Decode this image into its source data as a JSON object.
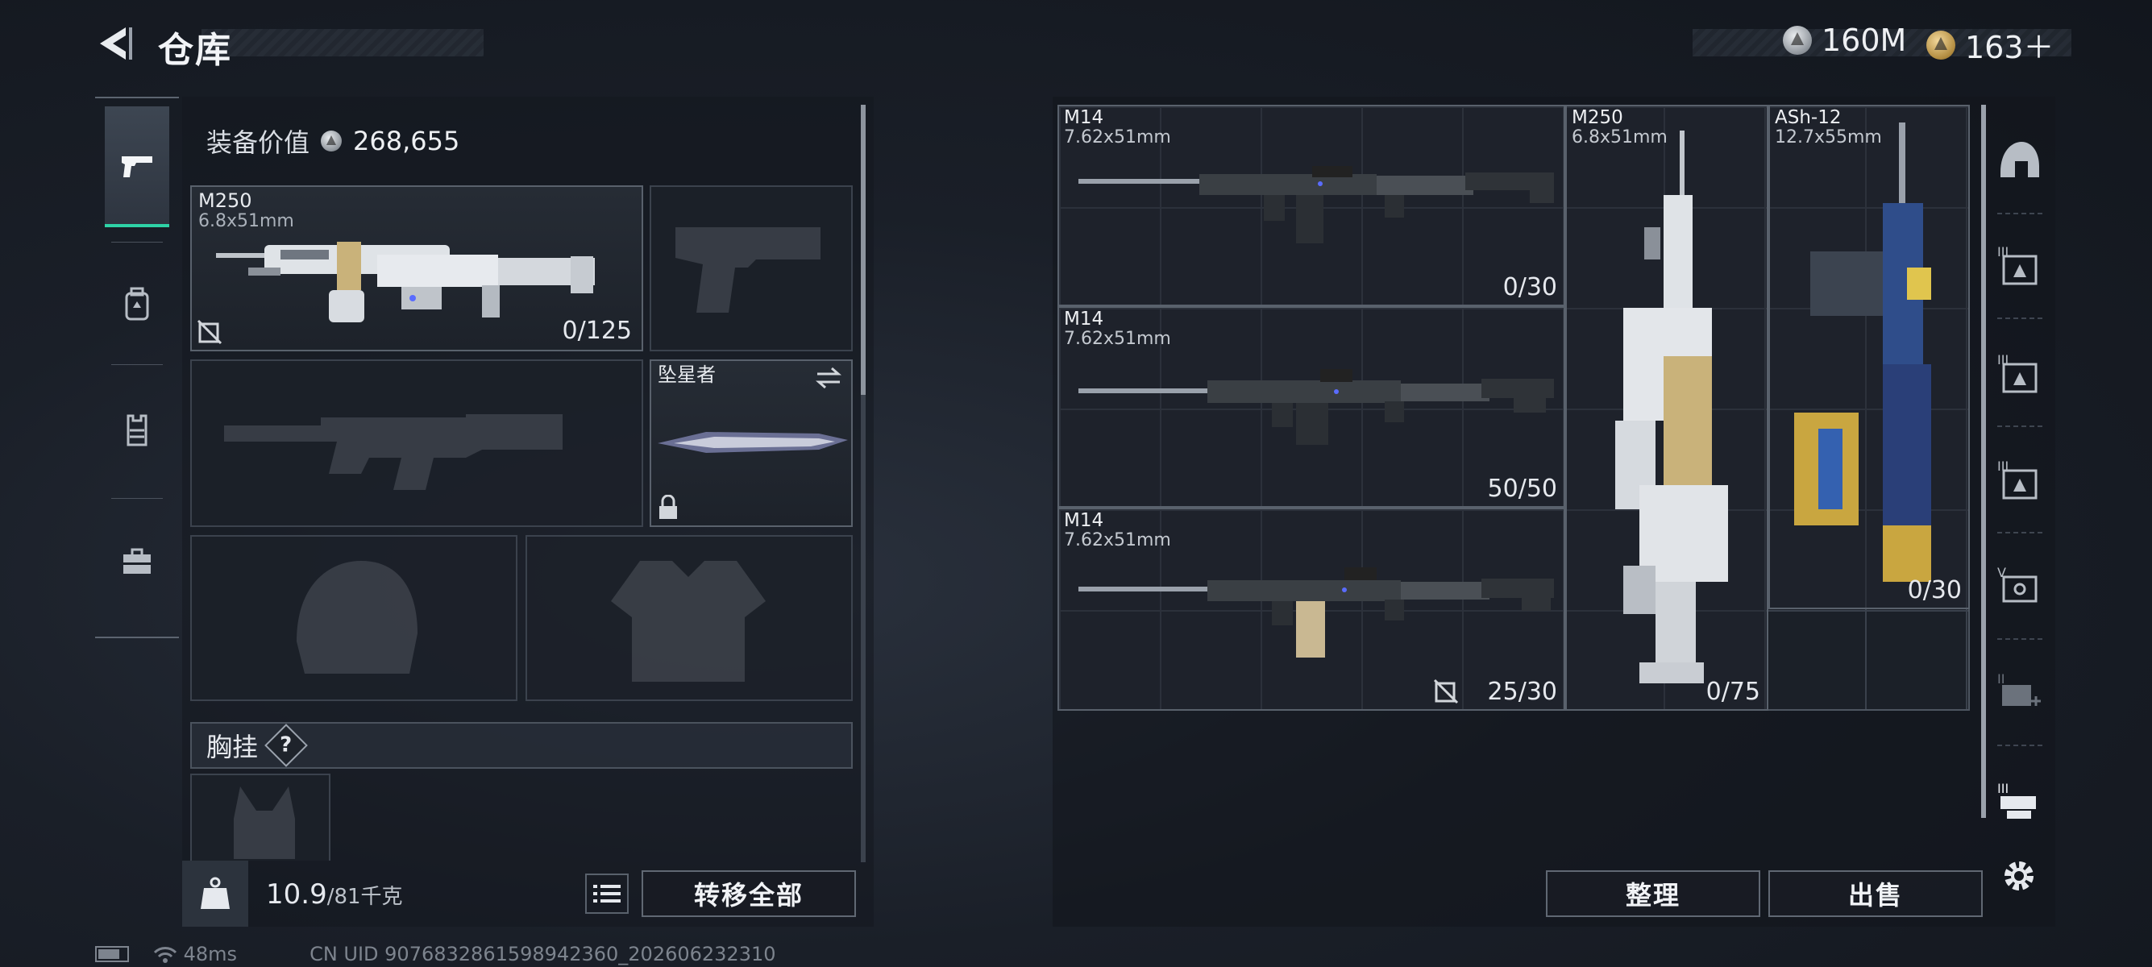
{
  "header": {
    "back_icon": "back-arrow-icon",
    "title": "仓库",
    "currency": [
      {
        "icon": "silver-coin-icon",
        "value": "160M"
      },
      {
        "icon": "gold-coin-icon",
        "value": "163＋"
      }
    ]
  },
  "category_tabs": [
    {
      "icon": "pistol-icon",
      "active": true
    },
    {
      "icon": "backpack-icon",
      "active": false
    },
    {
      "icon": "vest-icon",
      "active": false
    },
    {
      "icon": "toolbox-icon",
      "active": false
    }
  ],
  "loadout": {
    "value_label": "装备价值",
    "value": "268,655",
    "primary": {
      "name": "M250",
      "caliber": "6.8x51mm",
      "ammo": "0/125",
      "flag_icon": "no-insure-icon"
    },
    "melee": {
      "name": "坠星者",
      "swap_icon": "swap-icon",
      "lock_icon": "lock-icon"
    },
    "chest_rig_label": "胸挂",
    "help_label": "?",
    "weight_current": "10.9",
    "weight_max": "/81千克",
    "list_icon": "list-icon",
    "transfer_all": "转移全部"
  },
  "stash": {
    "items": [
      {
        "name": "M14",
        "caliber": "7.62x51mm",
        "ammo": "0/30"
      },
      {
        "name": "M14",
        "caliber": "7.62x51mm",
        "ammo": "50/50"
      },
      {
        "name": "M14",
        "caliber": "7.62x51mm",
        "ammo": "25/30"
      },
      {
        "name": "M250",
        "caliber": "6.8x51mm",
        "ammo": "0/75"
      },
      {
        "name": "ASh-12",
        "caliber": "12.7x55mm",
        "ammo": "0/30"
      }
    ],
    "sort_button": "整理",
    "sell_button": "出售"
  },
  "side_filters": [
    "helmet-icon",
    "tier3-armor-filter-icon",
    "tier3-armor-filter-icon",
    "tier3-armor-filter-icon",
    "tier5-case-filter-icon",
    "tier2-medkit-filter-icon",
    "tier3-container-filter-icon",
    "settings-gear-icon"
  ],
  "status": {
    "ping": "48ms",
    "uid": "CN UID 9076832861598942360_202606232310"
  },
  "colors": {
    "accent": "#2ed3a6",
    "text": "#e6e9ee",
    "border": "#59616c"
  }
}
